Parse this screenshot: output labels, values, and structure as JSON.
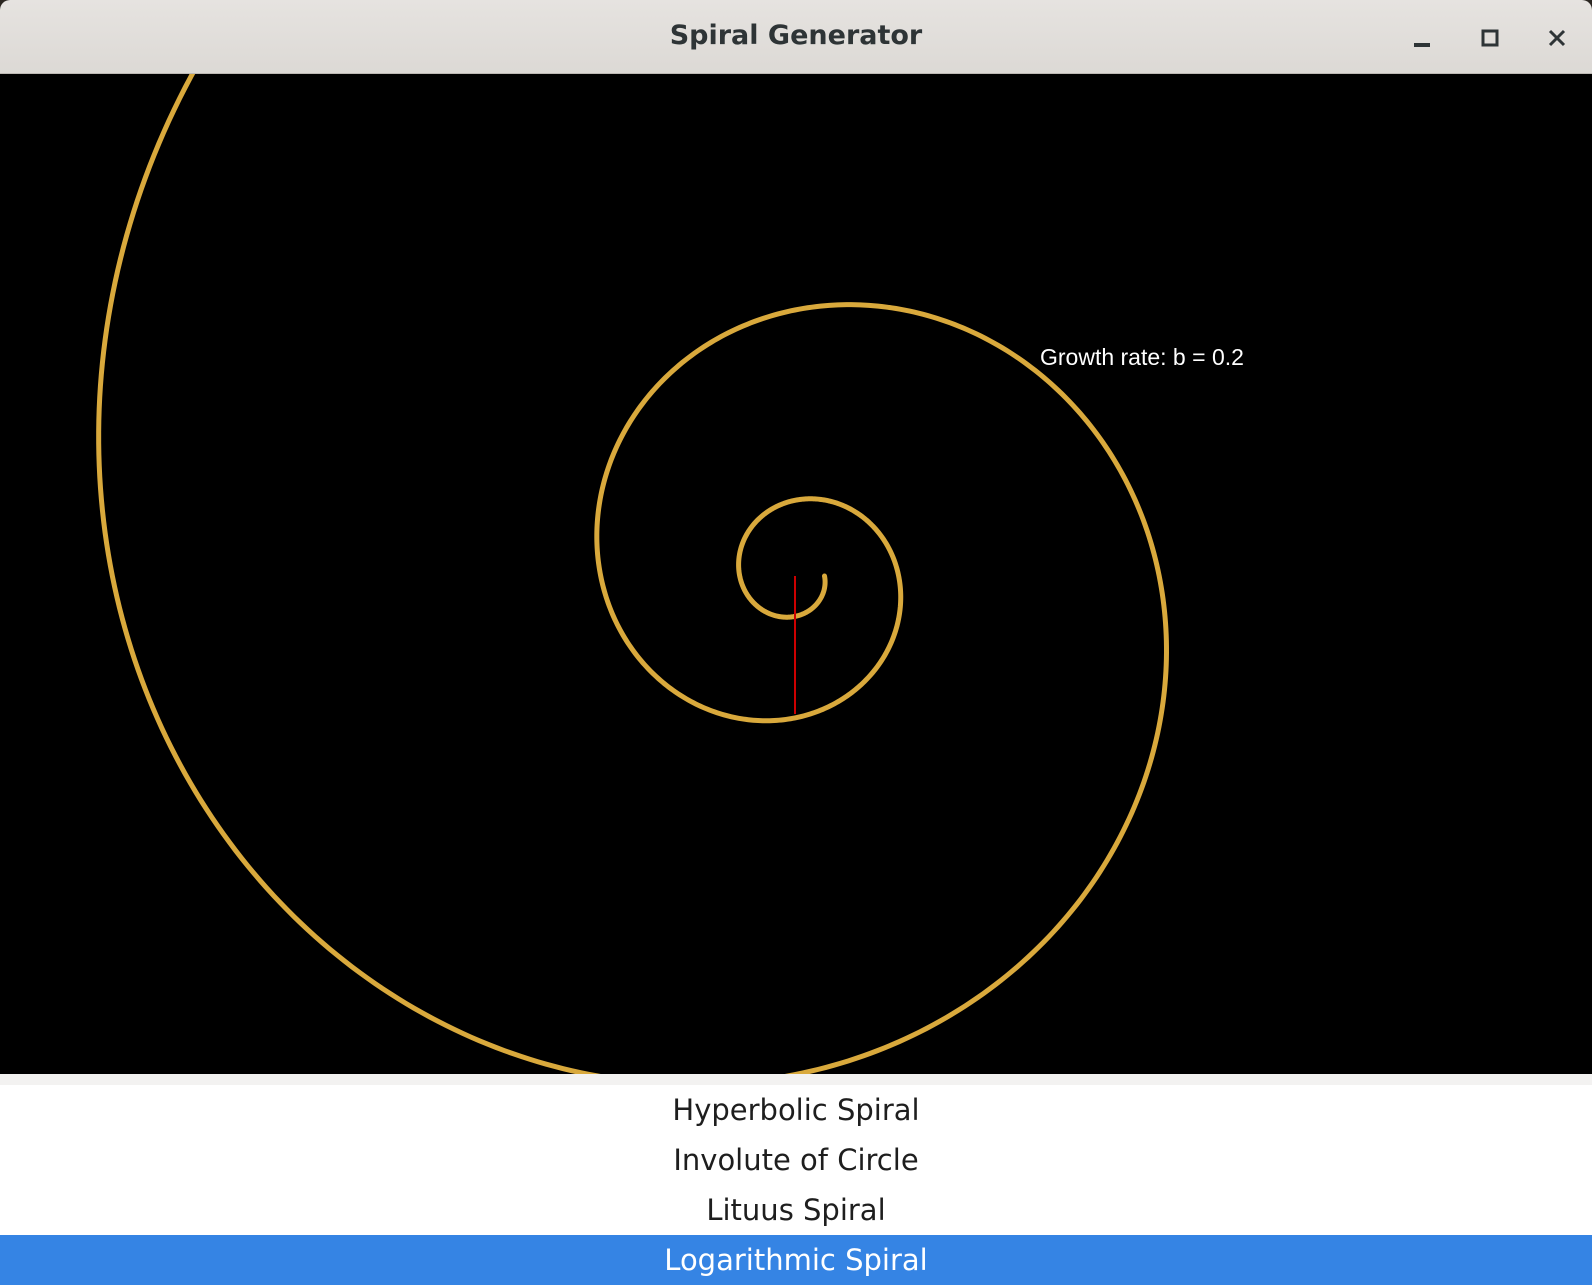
{
  "window": {
    "title": "Spiral Generator",
    "controls": [
      "minimize-icon",
      "maximize-icon",
      "close-icon"
    ]
  },
  "canvas": {
    "background": "#000000",
    "spiral_color": "#d9a93c",
    "radius_line_color": "#cc0000",
    "growth_label": "Growth rate: b = 0.2"
  },
  "spiral_list": {
    "items": [
      {
        "label": "Hyperbolic Spiral",
        "selected": false
      },
      {
        "label": "Involute of Circle",
        "selected": false
      },
      {
        "label": "Lituus Spiral",
        "selected": false
      },
      {
        "label": "Logarithmic Spiral",
        "selected": true
      }
    ],
    "selected_color": "#3584e4"
  }
}
